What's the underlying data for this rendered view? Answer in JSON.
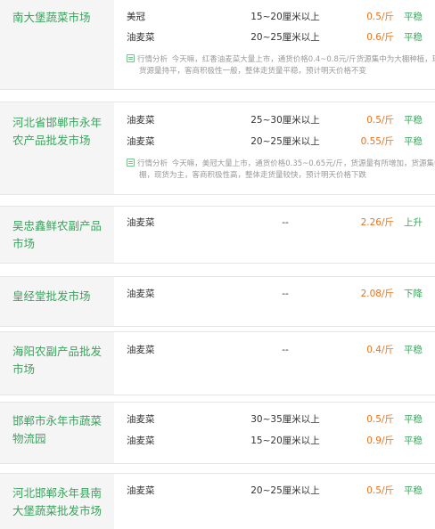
{
  "markets": [
    {
      "name": "南大堡蔬菜市场",
      "rows": [
        {
          "variety": "美冠",
          "spec": "15~20厘米以上",
          "price": "0.5/斤",
          "trend": "平稳"
        },
        {
          "variety": "油麦菜",
          "spec": "20~25厘米以上",
          "price": "0.6/斤",
          "trend": "平稳"
        }
      ],
      "analysis": {
        "label": "行情分析",
        "line1": "今天嘛，红香油麦菜大量上市，通货价格0.4~0.8元/斤货源集中为大棚种植，现",
        "line2": "货源量持平，客商积极性一般，整体走货量平稳，预计明天价格不变"
      }
    },
    {
      "name": "河北省邯郸市永年农产品批发市场",
      "rows": [
        {
          "variety": "油麦菜",
          "spec": "25~30厘米以上",
          "price": "0.5/斤",
          "trend": "平稳"
        },
        {
          "variety": "油麦菜",
          "spec": "20~25厘米以上",
          "price": "0.55/斤",
          "trend": "平稳"
        }
      ],
      "analysis": {
        "label": "行情分析",
        "line1": "今天嘛，美冠大量上市，通货价格0.35~0.65元/斤，货源量有所增加，货源集中",
        "line2": "棚，现货为主，客商积极性高，整体走货量较快，预计明天价格下跌"
      }
    },
    {
      "name": "吴忠鑫鲜农副产品市场",
      "rows": [
        {
          "variety": "油麦菜",
          "spec": "--",
          "price": "2.26/斤",
          "trend": "上升"
        }
      ]
    },
    {
      "name": "皇经堂批发市场",
      "rows": [
        {
          "variety": "油麦菜",
          "spec": "--",
          "price": "2.08/斤",
          "trend": "下降"
        }
      ]
    },
    {
      "name": "海阳农副产品批发市场",
      "rows": [
        {
          "variety": "油麦菜",
          "spec": "--",
          "price": "0.4/斤",
          "trend": "平稳"
        }
      ]
    },
    {
      "name": "邯郸市永年市蔬菜物流园",
      "rows": [
        {
          "variety": "油麦菜",
          "spec": "30~35厘米以上",
          "price": "0.5/斤",
          "trend": "平稳"
        },
        {
          "variety": "油麦菜",
          "spec": "15~20厘米以上",
          "price": "0.9/斤",
          "trend": "平稳"
        }
      ]
    },
    {
      "name": "河北邯郸永年县南大堡蔬菜批发市场",
      "rows": [
        {
          "variety": "油麦菜",
          "spec": "20~25厘米以上",
          "price": "0.5/斤",
          "trend": "平稳"
        }
      ]
    }
  ],
  "colors": {
    "market_name": "#3aa35d",
    "price": "#e9731a",
    "trend": "#3aa35d",
    "name_cell_bg": "#f5f5f5",
    "analysis_text": "#999999"
  },
  "icons": {
    "analysis": "analysis-doc-icon"
  }
}
